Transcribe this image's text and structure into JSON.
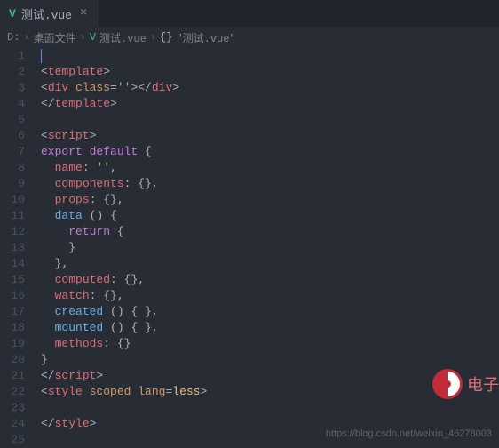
{
  "tab": {
    "icon": "V",
    "title": "测试.vue",
    "close": "×"
  },
  "breadcrumb": {
    "drive": "D:",
    "folder": "桌面文件",
    "file": "测试.vue",
    "symbol_brace": "{}",
    "symbol": "\"测试.vue\"",
    "chev": "›"
  },
  "lines": [
    {
      "n": 1,
      "t": []
    },
    {
      "n": 2,
      "t": [
        [
          "c-punc",
          "<"
        ],
        [
          "c-tag",
          "template"
        ],
        [
          "c-punc",
          ">"
        ]
      ]
    },
    {
      "n": 3,
      "t": [
        [
          "c-punc",
          "<"
        ],
        [
          "c-tag",
          "div"
        ],
        [
          "",
          ""
        ],
        [
          "c-attr",
          " class"
        ],
        [
          "c-punc",
          "="
        ],
        [
          "c-str",
          "''"
        ],
        [
          "c-punc",
          "></"
        ],
        [
          "c-tag",
          "div"
        ],
        [
          "c-punc",
          ">"
        ]
      ]
    },
    {
      "n": 4,
      "t": [
        [
          "c-punc",
          "</"
        ],
        [
          "c-tag",
          "template"
        ],
        [
          "c-punc",
          ">"
        ]
      ]
    },
    {
      "n": 5,
      "t": []
    },
    {
      "n": 6,
      "t": [
        [
          "c-punc",
          "<"
        ],
        [
          "c-tag",
          "script"
        ],
        [
          "c-punc",
          ">"
        ]
      ]
    },
    {
      "n": 7,
      "t": [
        [
          "c-kw",
          "export"
        ],
        [
          "",
          " "
        ],
        [
          "c-kw",
          "default"
        ],
        [
          "",
          " "
        ],
        [
          "c-brace",
          "{"
        ]
      ]
    },
    {
      "n": 8,
      "t": [
        [
          "",
          "  "
        ],
        [
          "c-prop",
          "name"
        ],
        [
          "c-punc",
          ": "
        ],
        [
          "c-str",
          "''"
        ],
        [
          "c-punc",
          ","
        ]
      ]
    },
    {
      "n": 9,
      "t": [
        [
          "",
          "  "
        ],
        [
          "c-prop",
          "components"
        ],
        [
          "c-punc",
          ": "
        ],
        [
          "c-brace",
          "{}"
        ],
        [
          "c-punc",
          ","
        ]
      ]
    },
    {
      "n": 10,
      "t": [
        [
          "",
          "  "
        ],
        [
          "c-prop",
          "props"
        ],
        [
          "c-punc",
          ": "
        ],
        [
          "c-brace",
          "{}"
        ],
        [
          "c-punc",
          ","
        ]
      ]
    },
    {
      "n": 11,
      "t": [
        [
          "",
          "  "
        ],
        [
          "c-func",
          "data"
        ],
        [
          "",
          " "
        ],
        [
          "c-brace",
          "()"
        ],
        [
          "",
          " "
        ],
        [
          "c-brace",
          "{"
        ]
      ]
    },
    {
      "n": 12,
      "t": [
        [
          "",
          "    "
        ],
        [
          "c-kw",
          "return"
        ],
        [
          "",
          " "
        ],
        [
          "c-brace",
          "{"
        ]
      ]
    },
    {
      "n": 13,
      "t": [
        [
          "",
          "    "
        ],
        [
          "c-brace",
          "}"
        ]
      ]
    },
    {
      "n": 14,
      "t": [
        [
          "",
          "  "
        ],
        [
          "c-brace",
          "}"
        ],
        [
          "c-punc",
          ","
        ]
      ]
    },
    {
      "n": 15,
      "t": [
        [
          "",
          "  "
        ],
        [
          "c-prop",
          "computed"
        ],
        [
          "c-punc",
          ": "
        ],
        [
          "c-brace",
          "{}"
        ],
        [
          "c-punc",
          ","
        ]
      ]
    },
    {
      "n": 16,
      "t": [
        [
          "",
          "  "
        ],
        [
          "c-prop",
          "watch"
        ],
        [
          "c-punc",
          ": "
        ],
        [
          "c-brace",
          "{}"
        ],
        [
          "c-punc",
          ","
        ]
      ]
    },
    {
      "n": 17,
      "t": [
        [
          "",
          "  "
        ],
        [
          "c-func",
          "created"
        ],
        [
          "",
          " "
        ],
        [
          "c-brace",
          "()"
        ],
        [
          "",
          " "
        ],
        [
          "c-brace",
          "{ }"
        ],
        [
          "c-punc",
          ","
        ]
      ]
    },
    {
      "n": 18,
      "t": [
        [
          "",
          "  "
        ],
        [
          "c-func",
          "mounted"
        ],
        [
          "",
          " "
        ],
        [
          "c-brace",
          "()"
        ],
        [
          "",
          " "
        ],
        [
          "c-brace",
          "{ }"
        ],
        [
          "c-punc",
          ","
        ]
      ]
    },
    {
      "n": 19,
      "t": [
        [
          "",
          "  "
        ],
        [
          "c-prop",
          "methods"
        ],
        [
          "c-punc",
          ": "
        ],
        [
          "c-brace",
          "{}"
        ]
      ]
    },
    {
      "n": 20,
      "t": [
        [
          "c-brace",
          "}"
        ]
      ]
    },
    {
      "n": 21,
      "t": [
        [
          "c-punc",
          "</"
        ],
        [
          "c-tag",
          "script"
        ],
        [
          "c-punc",
          ">"
        ]
      ]
    },
    {
      "n": 22,
      "t": [
        [
          "c-punc",
          "<"
        ],
        [
          "c-tag",
          "style"
        ],
        [
          "c-attr",
          " scoped lang"
        ],
        [
          "c-punc",
          "="
        ],
        [
          "c-default",
          "less"
        ],
        [
          "c-punc",
          ">"
        ]
      ]
    },
    {
      "n": 23,
      "t": []
    },
    {
      "n": 24,
      "t": [
        [
          "c-punc",
          "</"
        ],
        [
          "c-tag",
          "style"
        ],
        [
          "c-punc",
          ">"
        ]
      ]
    },
    {
      "n": 25,
      "t": []
    }
  ],
  "watermark": "https://blog.csdn.net/weixin_46278003",
  "csdn": {
    "text": "电子"
  }
}
